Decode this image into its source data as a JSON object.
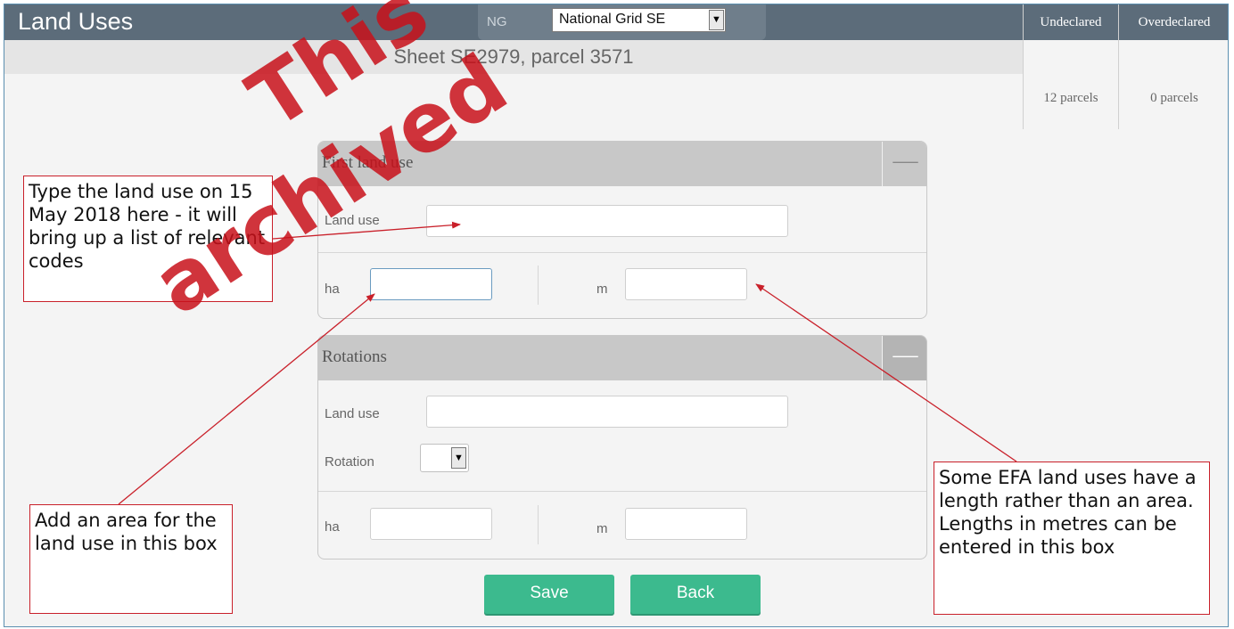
{
  "header": {
    "title": "Land Uses",
    "grid_prefix": "NG",
    "grid_select_value": "National Grid SE",
    "parcel_title": "Sheet SE2979, parcel 3571"
  },
  "stats": {
    "undeclared_label": "Undeclared",
    "undeclared_value": "12 parcels",
    "overdeclared_label": "Overdeclared",
    "overdeclared_value": "0 parcels"
  },
  "first_land_use": {
    "heading": "First land use",
    "collapse_icon": "minus-icon",
    "land_use_label": "Land use",
    "land_use_value": "",
    "ha_label": "ha",
    "ha_value": "",
    "m_label": "m",
    "m_value": ""
  },
  "rotations": {
    "heading": "Rotations",
    "collapse_icon": "minus-icon",
    "land_use_label": "Land use",
    "land_use_value": "",
    "rotation_label": "Rotation",
    "rotation_value": "",
    "ha_label": "ha",
    "ha_value": "",
    "m_label": "m",
    "m_value": ""
  },
  "actions": {
    "save_label": "Save",
    "back_label": "Back"
  },
  "callouts": {
    "land_use": "Type the land use on 15 May 2018 here - it will bring up a list of relevant codes",
    "area": "Add an area for the land use in this box",
    "length": "Some EFA land uses have a length rather than an area. Lengths in metres can be entered in this box"
  },
  "watermark": {
    "line1": "This",
    "line2": "archived"
  },
  "colors": {
    "header_bg": "#5c6c7a",
    "button_green": "#3cba8e",
    "callout_border": "#c9202a"
  }
}
